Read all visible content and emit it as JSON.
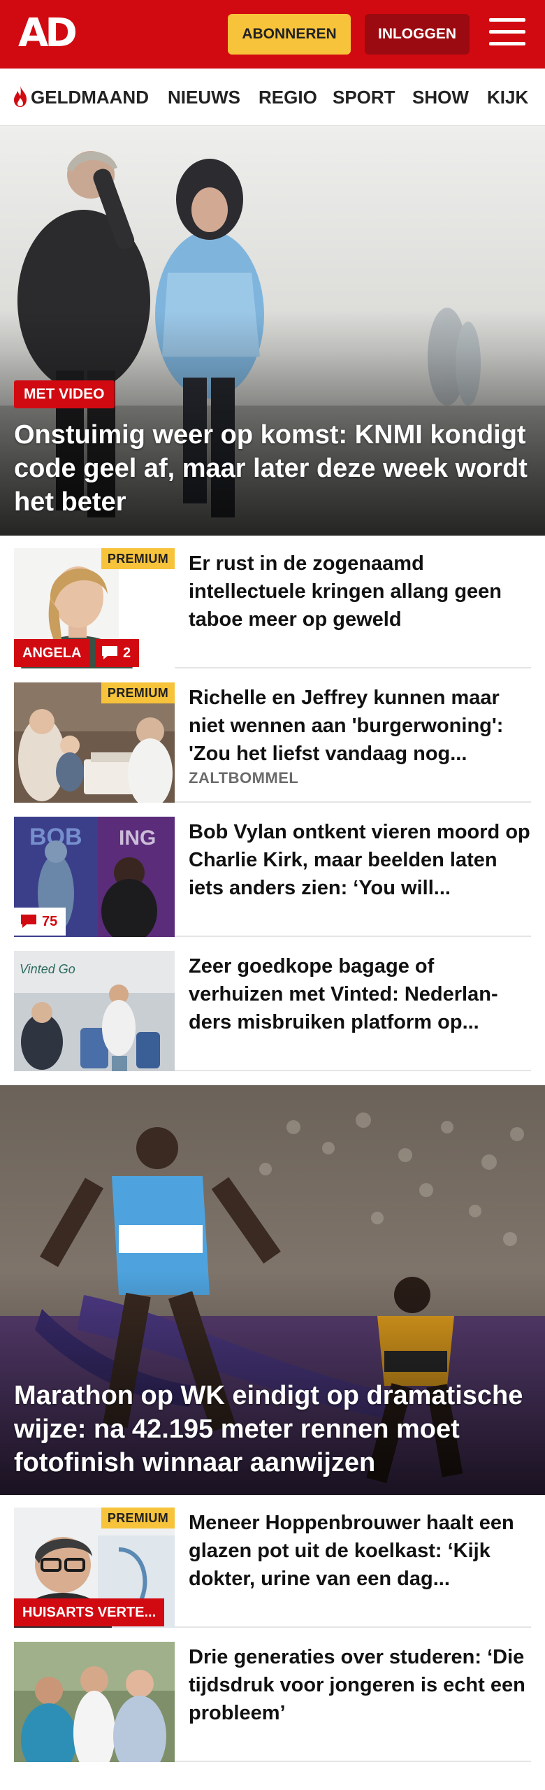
{
  "header": {
    "logo": "AD",
    "subscribe_label": "ABONNEREN",
    "login_label": "INLOGGEN"
  },
  "nav": {
    "items": [
      "GELDMAAND",
      "NIEUWS",
      "REGIO",
      "SPORT",
      "SHOW",
      "KIJK"
    ]
  },
  "hero_1": {
    "badge": "MET VIDEO",
    "title": "Onstuimig weer op komst: KNMI kondigt code geel af, maar later deze week wordt het beter"
  },
  "articles_1": [
    {
      "title": "Er rust in de zogenaamd intellectuele kringen allang geen taboe meer op geweld",
      "premium": "PREMIUM",
      "tag": "ANGELA",
      "comments": "2"
    },
    {
      "title": "Richelle en Jeffrey kunnen maar niet wennen aan 'burgerwoning': 'Zou het liefst vandaag nog...",
      "premium": "PREMIUM",
      "location": "ZALTBOMMEL"
    },
    {
      "title": "Bob Vylan ontkent vieren moord op Charlie Kirk, maar beelden laten iets anders zien: ‘You will...",
      "comments": "75"
    },
    {
      "title": "Zeer goedkope bagage of verhuizen met Vinted: Nederlan­ders misbruiken platform op..."
    }
  ],
  "hero_2": {
    "title": "Marathon op WK eindigt op dramati­sche wijze: na 42.195 meter rennen moet fotofinish winnaar aanwijzen"
  },
  "articles_2": [
    {
      "title": "Meneer Hoppenbrouwer haalt een glazen pot uit de koelkast: ‘Kijk dokter, urine van een dag...",
      "premium": "PREMIUM",
      "tag": "HUISARTS VERTE..."
    },
    {
      "title": "Drie generaties over studeren: ‘Die tijdsdruk voor jongeren is echt een probleem’"
    }
  ],
  "colors": {
    "brand_red": "#d10a11",
    "premium_yellow": "#f7c33b",
    "login_dark_red": "#9b0a10"
  },
  "icons": [
    "flame-icon",
    "hamburger-menu-icon",
    "comment-bubble-icon"
  ]
}
